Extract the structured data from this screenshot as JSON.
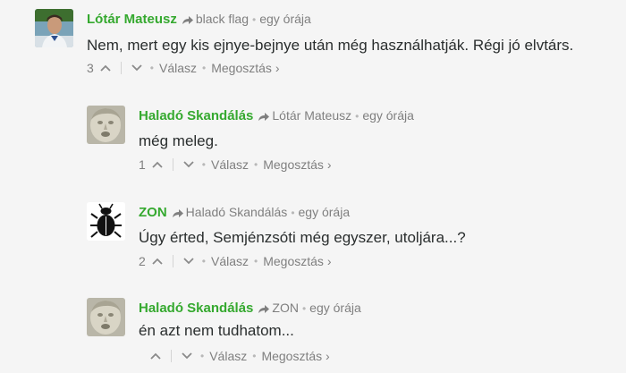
{
  "comments": [
    {
      "author": "Lótár Mateusz",
      "reply_to": "black flag",
      "time": "egy órája",
      "text": "Nem, mert egy kis ejnye-bejnye után még használhatják. Régi jó elvtárs.",
      "votes": "3",
      "reply_label": "Válasz",
      "share_label": "Megosztás ›"
    },
    {
      "author": "Haladó Skandálás",
      "reply_to": "Lótár Mateusz",
      "time": "egy órája",
      "text": "még meleg.",
      "votes": "1",
      "reply_label": "Válasz",
      "share_label": "Megosztás ›"
    },
    {
      "author": "ZON",
      "reply_to": "Haladó Skandálás",
      "time": "egy órája",
      "text": "Úgy érted, Semjénzsóti még egyszer, utoljára...?",
      "votes": "2",
      "reply_label": "Válasz",
      "share_label": "Megosztás ›"
    },
    {
      "author": "Haladó Skandálás",
      "reply_to": "ZON",
      "time": "egy órája",
      "text": "én azt nem tudhatom...",
      "votes": "",
      "reply_label": "Válasz",
      "share_label": "Megosztás ›"
    }
  ],
  "colors": {
    "author": "#35a92f",
    "meta": "#7f7f7f",
    "text": "#2a2e2e",
    "background": "#f5f5f5"
  },
  "icons": [
    "reply-arrow-icon",
    "upvote-chevron-icon",
    "downvote-chevron-icon",
    "user-avatar",
    "scarab-avatar"
  ]
}
